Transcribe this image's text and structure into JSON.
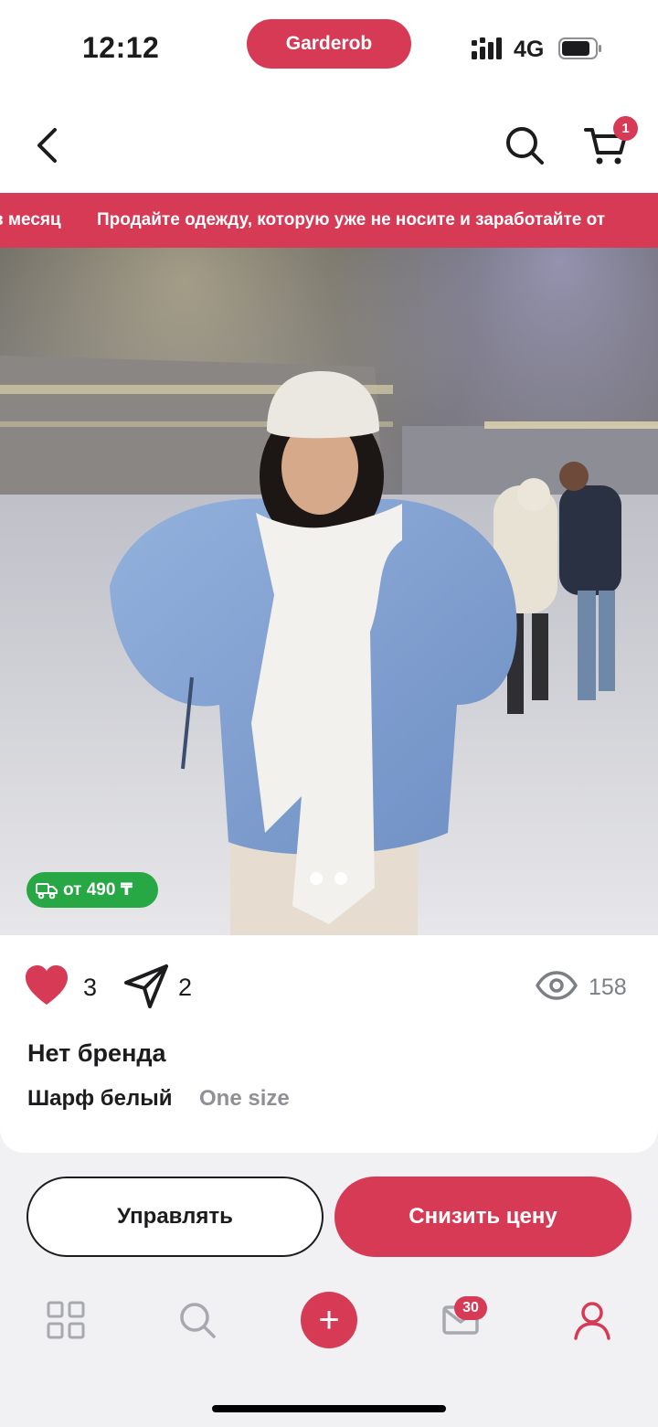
{
  "status_bar": {
    "time": "12:12",
    "app_pill": "Garderob",
    "network": "4G"
  },
  "header": {
    "back_icon": "chevron-left-icon",
    "search_icon": "search-icon",
    "cart_icon": "cart-icon",
    "cart_count": "1"
  },
  "banner": {
    "fragment": "в месяц",
    "text": "Продайте одежду, которую уже не носите и заработайте от"
  },
  "gallery": {
    "delivery_label": "от 490 ₸",
    "page_count": 2,
    "current_page": 2
  },
  "product": {
    "likes": "3",
    "shares": "2",
    "views": "158",
    "brand": "Нет бренда",
    "name": "Шарф белый",
    "size": "One size"
  },
  "actions": {
    "manage": "Управлять",
    "lower_price": "Снизить цену"
  },
  "tabbar": {
    "plus": "+",
    "messages_badge": "30"
  },
  "colors": {
    "accent": "#d63a55",
    "delivery_green": "#28a745"
  }
}
